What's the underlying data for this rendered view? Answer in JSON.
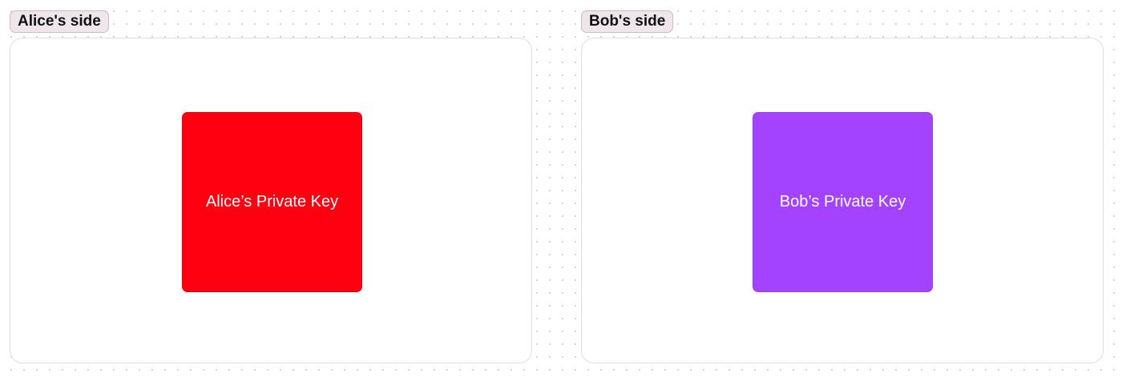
{
  "alice": {
    "tag_label": "Alice's side",
    "key_label": "Alice’s Private Key",
    "key_color": "#ff0010"
  },
  "bob": {
    "tag_label": "Bob's side",
    "key_label": "Bob’s Private Key",
    "key_color": "#a443ff"
  }
}
